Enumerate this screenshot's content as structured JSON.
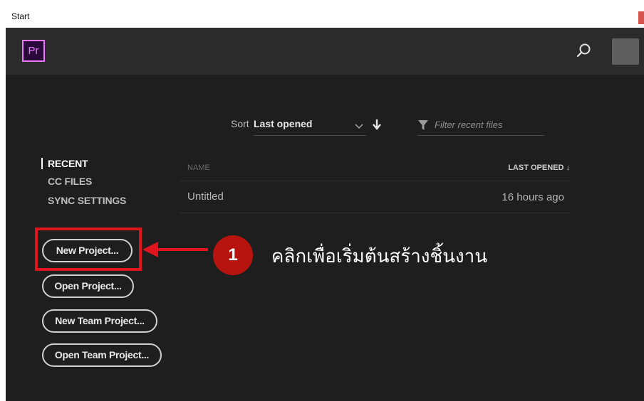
{
  "window": {
    "title": "Start"
  },
  "app": {
    "logo_text": "Pr",
    "brand_color": "#ea77ff"
  },
  "toolbar": {
    "search_icon": "search-icon",
    "avatar": "user-avatar"
  },
  "sort": {
    "label": "Sort",
    "value": "Last opened",
    "options": [
      "Last opened"
    ]
  },
  "filter": {
    "placeholder": "Filter recent files"
  },
  "nav": {
    "items": [
      {
        "label": "RECENT",
        "active": true
      },
      {
        "label": "CC FILES",
        "active": false
      },
      {
        "label": "SYNC SETTINGS",
        "active": false
      }
    ]
  },
  "table": {
    "columns": {
      "name": "NAME",
      "last_opened": "LAST OPENED ↓"
    },
    "rows": [
      {
        "name": "Untitled",
        "last_opened": "16 hours ago"
      }
    ]
  },
  "actions": {
    "new_project": "New Project...",
    "open_project": "Open Project...",
    "new_team_project": "New Team Project...",
    "open_team_project": "Open Team Project..."
  },
  "annotation": {
    "step": "1",
    "text": "คลิกเพื่อเริ่มต้นสร้างชิ้นงาน",
    "color": "#e0141c",
    "badge_color": "#b8140f"
  }
}
